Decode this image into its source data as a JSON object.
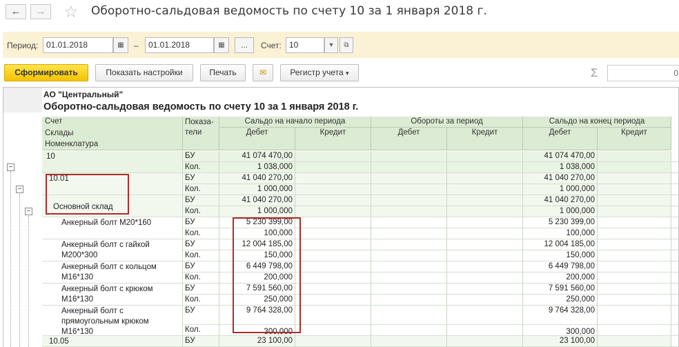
{
  "nav": {
    "back": "←",
    "forward": "→",
    "title": "Оборотно-сальдовая ведомость по счету 10 за 1 января 2018 г."
  },
  "period": {
    "label": "Период:",
    "from": "01.01.2018",
    "dash": "–",
    "to": "01.01.2018",
    "more": "...",
    "account_label": "Счет:",
    "account": "10"
  },
  "toolbar": {
    "generate": "Сформировать",
    "settings": "Показать настройки",
    "print": "Печать",
    "register": "Регистр учета",
    "sigma": "Σ",
    "sum_value": "0"
  },
  "report": {
    "org": "АО \"Центральный\"",
    "title": "Оборотно-сальдовая ведомость по счету 10 за 1 января 2018 г.",
    "headers": {
      "account": "Счет",
      "warehouses": "Склады",
      "nomenclature": "Номенклатура",
      "indicators": "Показа-\nтели",
      "opening": "Сальдо на начало периода",
      "turnover": "Обороты за период",
      "closing": "Сальдо на конец периода",
      "debit": "Дебет",
      "credit": "Кредит"
    },
    "groups": [
      {
        "name": "10",
        "level": 0,
        "rows": [
          {
            "ind": "БУ",
            "open_d": "41 074 470,00",
            "close_d": "41 074 470,00"
          },
          {
            "ind": "Кол.",
            "open_d": "1 038,000",
            "close_d": "1 038,000"
          }
        ]
      },
      {
        "name": "10.01",
        "level": 1,
        "rows": [
          {
            "ind": "БУ",
            "open_d": "41 040 270,00",
            "close_d": "41 040 270,00"
          },
          {
            "ind": "Кол.",
            "open_d": "1 000,000",
            "close_d": "1 000,000"
          }
        ]
      },
      {
        "name": "Основной склад",
        "level": 2,
        "rows": [
          {
            "ind": "БУ",
            "open_d": "41 040 270,00",
            "close_d": "41 040 270,00"
          },
          {
            "ind": "Кол.",
            "open_d": "1 000,000",
            "close_d": "1 000,000"
          }
        ]
      },
      {
        "name": "Анкерный болт М20*160",
        "level": 3,
        "rows": [
          {
            "ind": "БУ",
            "open_d": "5 230 399,00",
            "close_d": "5 230 399,00"
          },
          {
            "ind": "Кол.",
            "open_d": "100,000",
            "close_d": "100,000"
          }
        ]
      },
      {
        "name": "Анкерный болт с гайкой\nМ200*300",
        "level": 3,
        "rows": [
          {
            "ind": "БУ",
            "open_d": "12 004 185,00",
            "close_d": "12 004 185,00"
          },
          {
            "ind": "Кол.",
            "open_d": "150,000",
            "close_d": "150,000"
          }
        ]
      },
      {
        "name": "Анкерный болт с кольцом\nМ16*130",
        "level": 3,
        "rows": [
          {
            "ind": "БУ",
            "open_d": "6 449 798,00",
            "close_d": "6 449 798,00"
          },
          {
            "ind": "Кол.",
            "open_d": "200,000",
            "close_d": "200,000"
          }
        ]
      },
      {
        "name": "Анкерный болт с крюком\nМ16*130",
        "level": 3,
        "rows": [
          {
            "ind": "БУ",
            "open_d": "7 591 560,00",
            "close_d": "7 591 560,00"
          },
          {
            "ind": "Кол.",
            "open_d": "250,000",
            "close_d": "250,000"
          }
        ]
      },
      {
        "name": "Анкерный болт с\nпрямоугольным крюком\nМ16*130",
        "level": 3,
        "tall": true,
        "rows": [
          {
            "ind": "БУ",
            "open_d": "9 764 328,00",
            "close_d": "9 764 328,00"
          },
          {
            "ind": "Кол.",
            "open_d": "300,000",
            "close_d": "300,000"
          }
        ]
      },
      {
        "name": "10.05",
        "level": 1,
        "rows": [
          {
            "ind": "БУ",
            "open_d": "23 100,00",
            "close_d": "23 100,00"
          }
        ]
      }
    ]
  }
}
